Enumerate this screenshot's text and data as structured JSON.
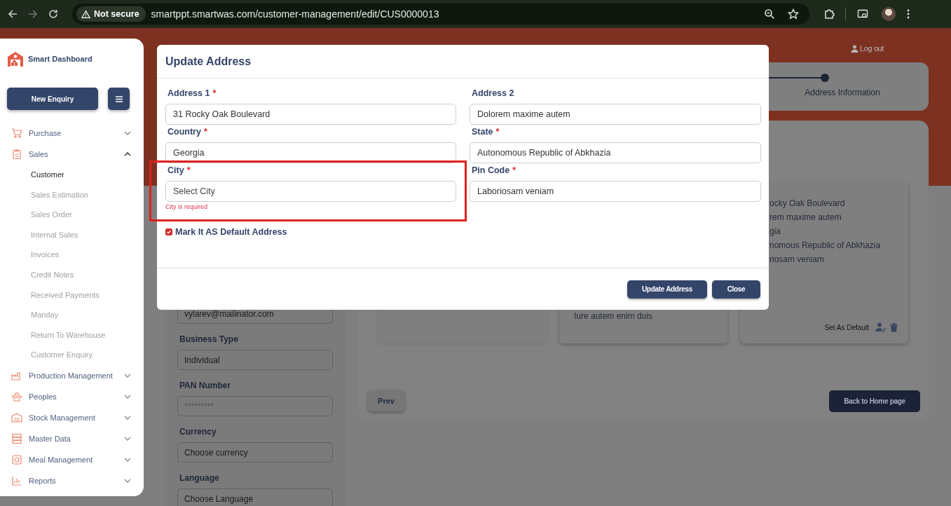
{
  "browser": {
    "security_label": "Not secure",
    "url": "smartppt.smartwas.com/customer-management/edit/CUS0000013"
  },
  "sidebar": {
    "brand": "Smart Dashboard",
    "new_button": "New Enquiry",
    "items": [
      {
        "label": "Purchase",
        "expanded": false
      },
      {
        "label": "Sales",
        "expanded": true,
        "children": [
          {
            "label": "Customer",
            "selected": true
          },
          {
            "label": "Sales Estimation",
            "selected": false
          },
          {
            "label": "Sales Order",
            "selected": false
          },
          {
            "label": "Internal Sales",
            "selected": false
          },
          {
            "label": "Invoices",
            "selected": false
          },
          {
            "label": "Credit Notes",
            "selected": false
          },
          {
            "label": "Received Payments",
            "selected": false
          },
          {
            "label": "Manday",
            "selected": false
          },
          {
            "label": "Return To Warehouse",
            "selected": false
          },
          {
            "label": "Customer Enquiry",
            "selected": false
          }
        ]
      },
      {
        "label": "Production Management",
        "expanded": false
      },
      {
        "label": "Peoples",
        "expanded": false
      },
      {
        "label": "Stock Management",
        "expanded": false
      },
      {
        "label": "Master Data",
        "expanded": false
      },
      {
        "label": "Meal Management",
        "expanded": false
      },
      {
        "label": "Reports",
        "expanded": false
      }
    ]
  },
  "header": {
    "logout": "Log out"
  },
  "stepper": {
    "step_label": "Address Information"
  },
  "customer_form": {
    "fields": [
      {
        "value": "vylarev@mailinator.com"
      },
      {
        "label": "Business Type",
        "value": "Individual"
      },
      {
        "label": "PAN Number",
        "placeholder": "*********"
      },
      {
        "label": "Currency",
        "value": "Choose currency"
      },
      {
        "label": "Language",
        "value": "Choose Language"
      }
    ]
  },
  "address_cards": [
    {
      "kind": "address"
    },
    {
      "kind": "address",
      "lines": [
        "Iure autem enim duis"
      ]
    },
    {
      "kind": "address",
      "lines": [
        "ocky Oak Boulevard",
        "rem maxime autem",
        "gia",
        "nomous Republic of Abkhazia",
        "riosam veniam"
      ],
      "default_action": "Set As Default"
    }
  ],
  "nav_buttons": {
    "prev": "Prev",
    "home": "Back to Home page"
  },
  "modal": {
    "title": "Update Address",
    "fields": [
      {
        "label": "Address 1",
        "required_mark": "*",
        "value": "31 Rocky Oak Boulevard"
      },
      {
        "label": "Address 2",
        "value": "Dolorem maxime autem"
      },
      {
        "label": "Country",
        "required_mark": "*",
        "value": "Georgia"
      },
      {
        "label": "State",
        "required_mark": "*",
        "value": "Autonomous Republic of Abkhazia"
      },
      {
        "label": "City",
        "required_mark": "*",
        "placeholder": "Select City",
        "error": "City is required"
      },
      {
        "label": "Pin Code",
        "required_mark": "*",
        "value": "Laboriosam veniam"
      }
    ],
    "default_checkbox": {
      "label": "Mark It AS Default Address",
      "checked": true
    },
    "buttons": [
      "Update Address",
      "Close"
    ]
  }
}
